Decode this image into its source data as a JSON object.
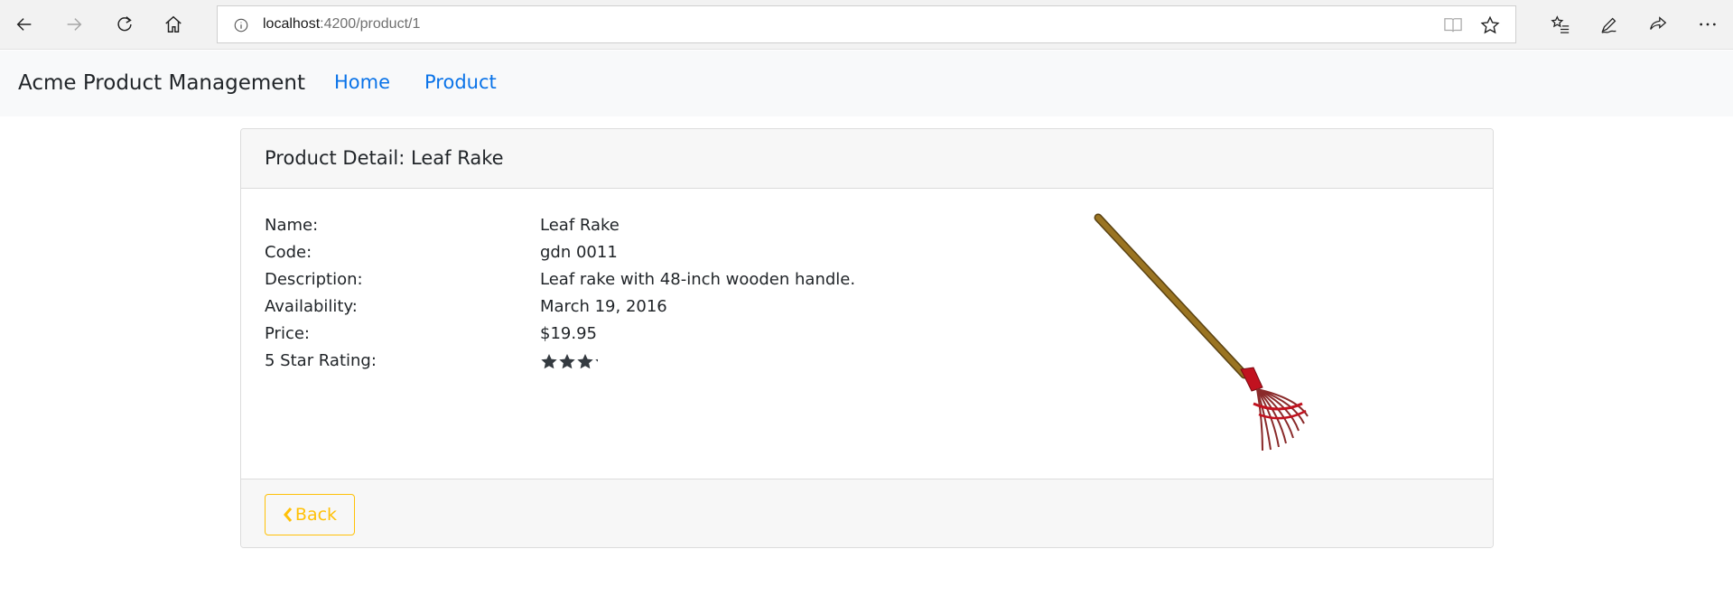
{
  "browser": {
    "address_host": "localhost",
    "address_path": ":4200/product/1",
    "icons": [
      "back-arrow-icon",
      "forward-arrow-icon",
      "refresh-icon",
      "home-icon",
      "info-icon",
      "reading-view-icon",
      "favorite-star-icon",
      "favorites-list-icon",
      "pen-icon",
      "share-icon",
      "more-icon"
    ]
  },
  "navbar": {
    "brand": "Acme Product Management",
    "links": [
      "Home",
      "Product"
    ],
    "link_color": "#0a73e8"
  },
  "card": {
    "title": "Product Detail: Leaf Rake",
    "fields": [
      {
        "label": "Name:",
        "value": "Leaf Rake"
      },
      {
        "label": "Code:",
        "value": "gdn 0011"
      },
      {
        "label": "Description:",
        "value": "Leaf rake with 48-inch wooden handle."
      },
      {
        "label": "Availability:",
        "value": "March 19, 2016"
      },
      {
        "label": "Price:",
        "value": "$19.95"
      },
      {
        "label": "5 Star Rating:",
        "value": ""
      }
    ],
    "rating": 3.2,
    "rating_max": 5,
    "image_icon": "leaf-rake-image",
    "back_label": "Back",
    "back_color": "#ffc107"
  }
}
